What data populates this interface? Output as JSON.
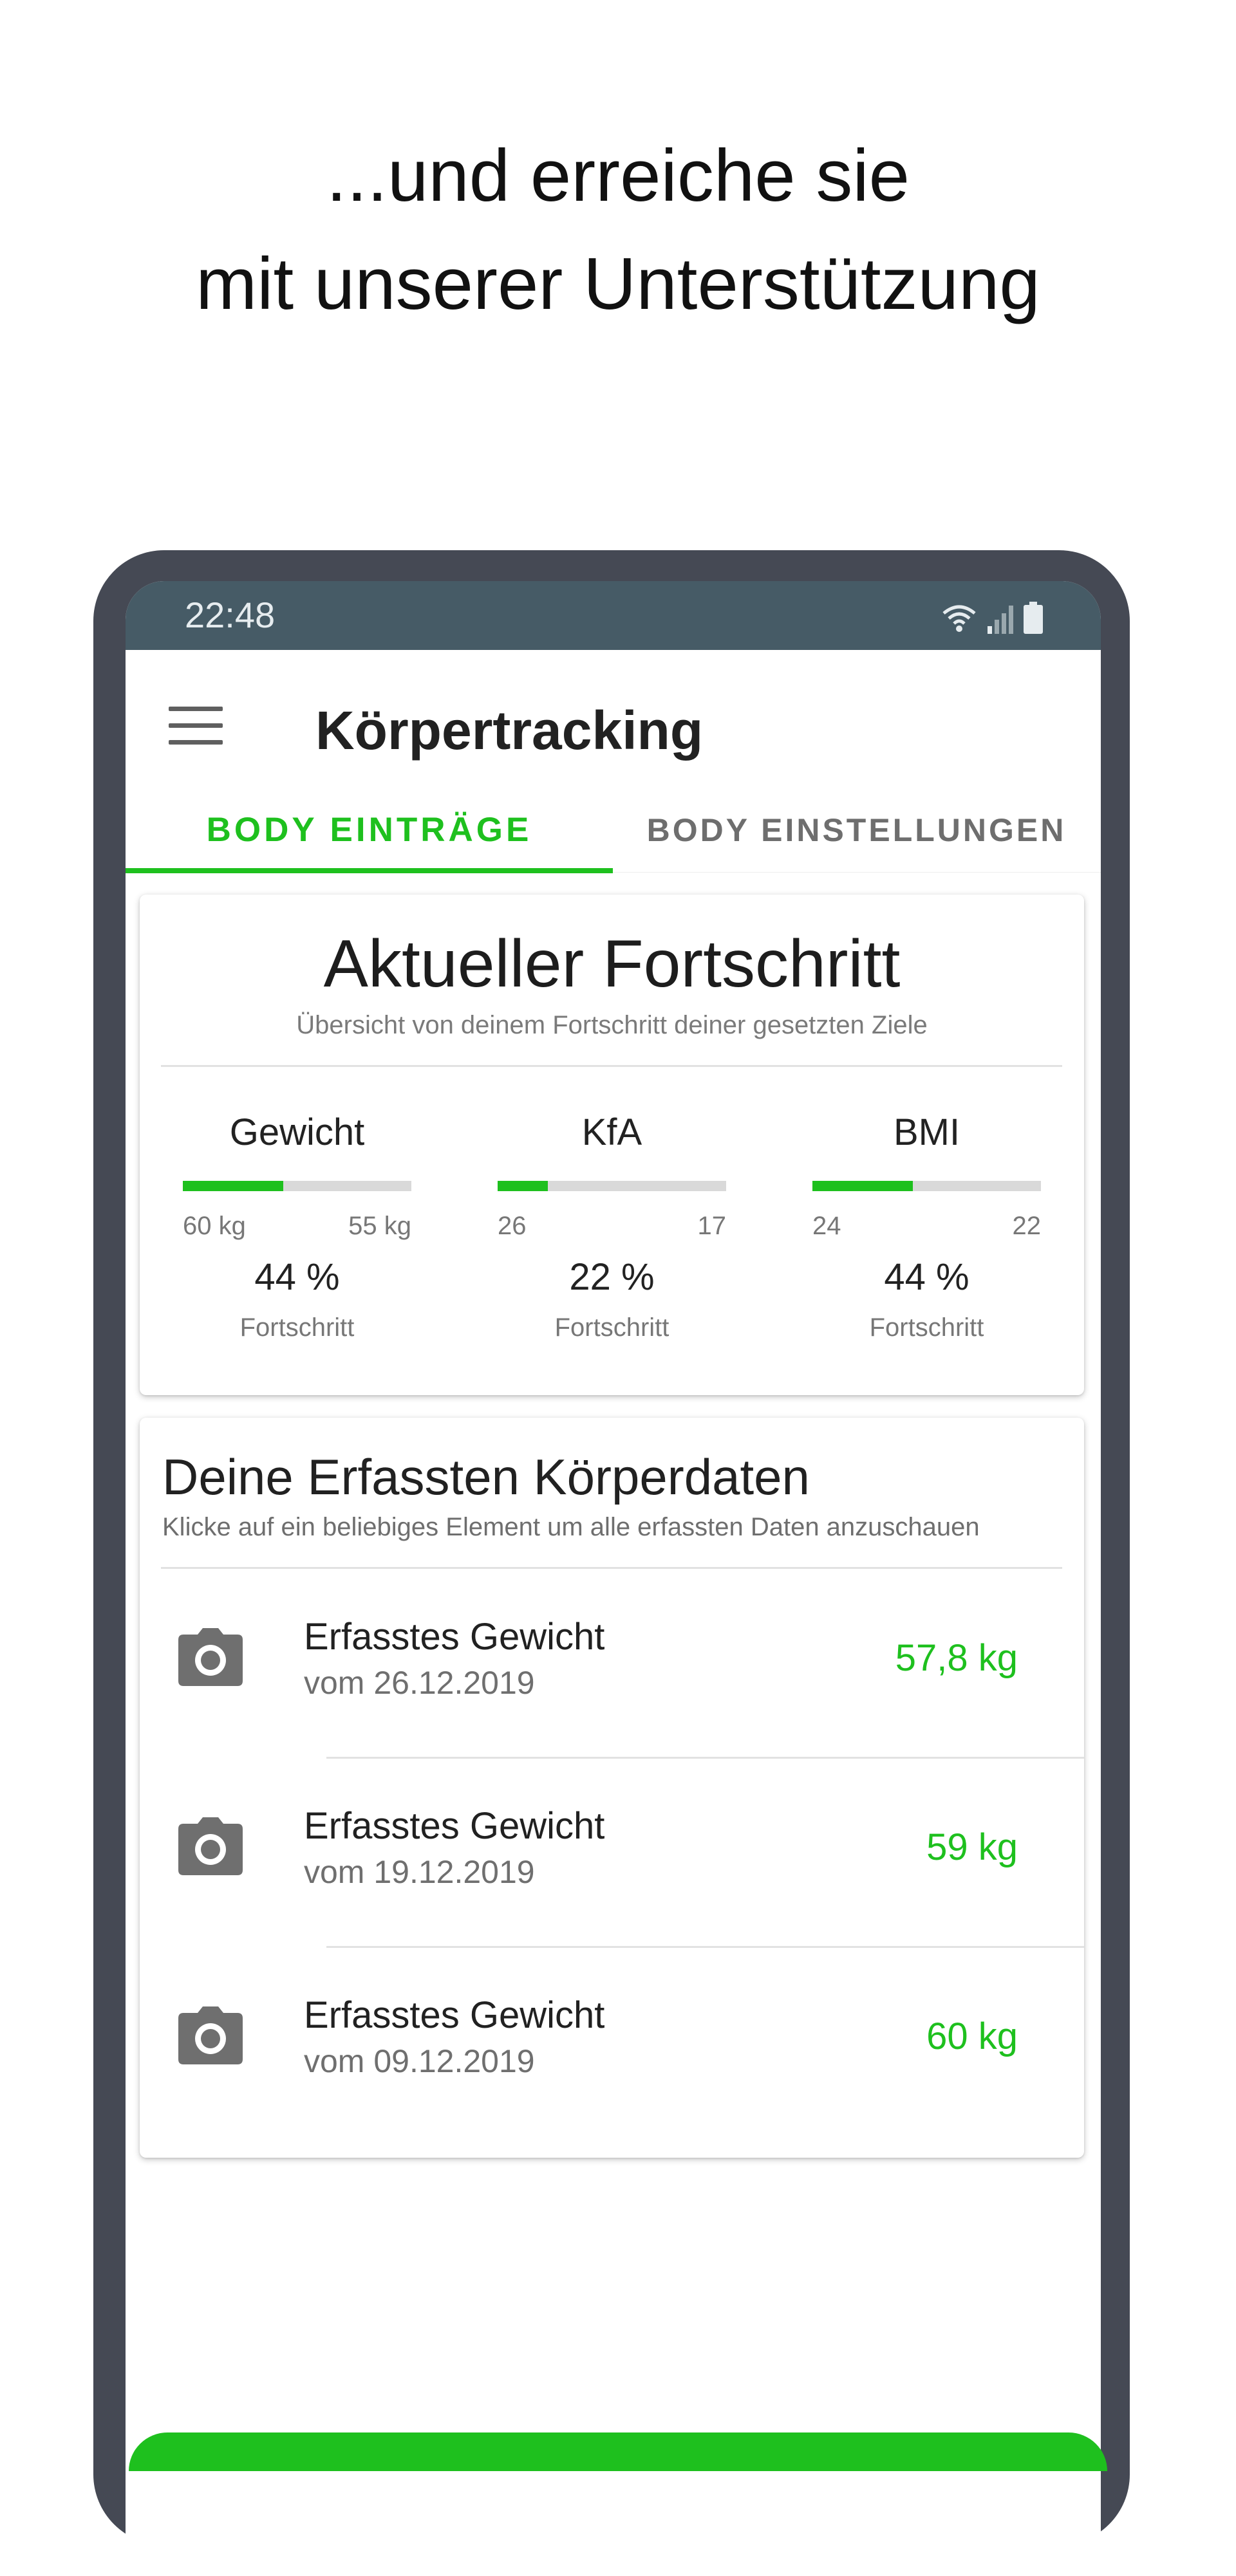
{
  "headline": {
    "line1": "...und erreiche sie",
    "line2": "mit unserer Unterstützung"
  },
  "statusbar": {
    "time": "22:48",
    "icons": [
      "wifi-icon",
      "signal-icon",
      "battery-icon"
    ]
  },
  "appbar": {
    "title": "Körpertracking",
    "menu_icon": "menu-icon"
  },
  "tabs": [
    {
      "label": "BODY EINTRÄGE",
      "active": true
    },
    {
      "label": "BODY EINSTELLUNGEN",
      "active": false
    }
  ],
  "progress_card": {
    "title": "Aktueller Fortschritt",
    "subtitle": "Übersicht von deinem Fortschritt deiner gesetzten Ziele",
    "metrics": [
      {
        "label": "Gewicht",
        "start": "60 kg",
        "goal": "55 kg",
        "percent_text": "44 %",
        "progress_fraction": 0.44,
        "caption": "Fortschritt"
      },
      {
        "label": "KfA",
        "start": "26",
        "goal": "17",
        "percent_text": "22 %",
        "progress_fraction": 0.22,
        "caption": "Fortschritt"
      },
      {
        "label": "BMI",
        "start": "24",
        "goal": "22",
        "percent_text": "44 %",
        "progress_fraction": 0.44,
        "caption": "Fortschritt"
      }
    ]
  },
  "data_card": {
    "title": "Deine Erfassten Körperdaten",
    "subtitle": "Klicke auf ein beliebiges Element um alle erfassten Daten anzuschauen",
    "entries": [
      {
        "title": "Erfasstes Gewicht",
        "date": "vom 26.12.2019",
        "value": "57,8 kg",
        "icon": "camera-icon"
      },
      {
        "title": "Erfasstes Gewicht",
        "date": "vom 19.12.2019",
        "value": "59 kg",
        "icon": "camera-icon"
      },
      {
        "title": "Erfasstes Gewicht",
        "date": "vom 09.12.2019",
        "value": "60 kg",
        "icon": "camera-icon"
      }
    ]
  },
  "colors": {
    "accent": "#1ec01e",
    "statusbar": "#465b66",
    "phone_frame": "#454954",
    "track": "#d9d9d9"
  }
}
